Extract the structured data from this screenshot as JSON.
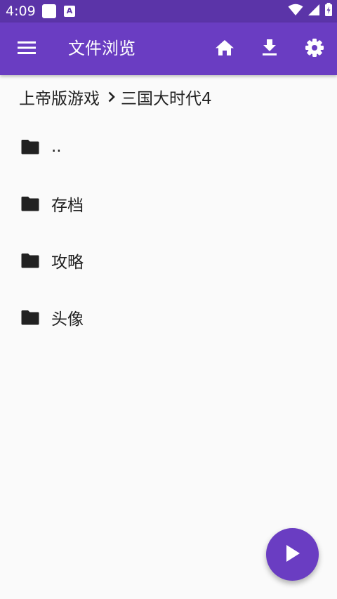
{
  "status_bar": {
    "time": "4:09",
    "notification_badge": "A",
    "icons": [
      "square-icon",
      "app-a-icon",
      "wifi-icon",
      "signal-icon",
      "battery-icon"
    ]
  },
  "app_bar": {
    "title": "文件浏览",
    "icons": [
      "menu-icon",
      "home-icon",
      "download-icon",
      "settings-icon"
    ]
  },
  "breadcrumb": {
    "items": [
      "上帝版游戏",
      "三国大时代4"
    ],
    "separator_icon": "chevron-right-icon"
  },
  "files": [
    {
      "name": "..",
      "icon": "folder-icon"
    },
    {
      "name": "存档",
      "icon": "folder-icon"
    },
    {
      "name": "攻略",
      "icon": "folder-icon"
    },
    {
      "name": "头像",
      "icon": "folder-icon"
    }
  ],
  "fab": {
    "icon": "play-icon"
  },
  "colors": {
    "status_bar": "#5b34a8",
    "app_bar": "#6a3dc2",
    "accent": "#6a3dc2",
    "background": "#fafafa",
    "text": "#212121"
  }
}
